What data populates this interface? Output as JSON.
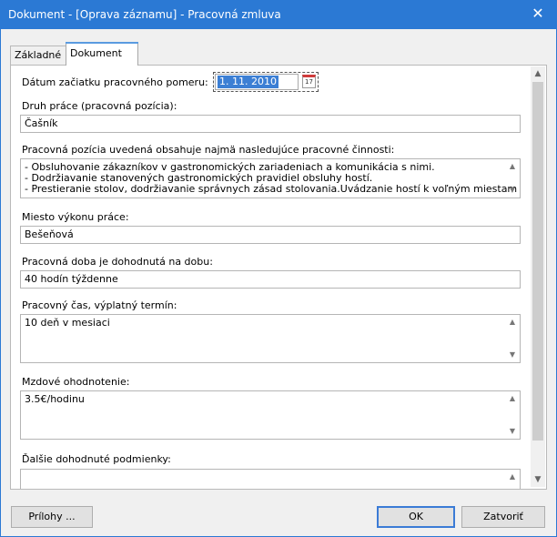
{
  "window": {
    "title": "Dokument - [Oprava záznamu]  - Pracovná zmluva",
    "close_glyph": "✕"
  },
  "tabs": [
    {
      "label": "Základné"
    },
    {
      "label": "Dokument"
    }
  ],
  "date_start": {
    "label": "Dátum začiatku pracovného pomeru:",
    "value": "1. 11. 2010",
    "calendar_text": "17"
  },
  "job_type": {
    "label": "Druh práce (pracovná pozícia):",
    "value": "Čašník"
  },
  "activities": {
    "label": "Pracovná pozícia uvedená obsahuje najmä nasledujúce pracovné činnosti:",
    "lines": [
      "- Obsluhovanie zákazníkov v gastronomických zariadeniach a komunikácia s nimi.",
      "- Dodržiavanie stanovených gastronomických pravidiel obsluhy hostí.",
      "- Prestieranie stolov, dodržiavanie správnych zásad stolovania.Uvádzanie hostí k voľným miestam na"
    ]
  },
  "place": {
    "label": "Miesto výkonu práce:",
    "value": "Bešeňová"
  },
  "duration": {
    "label": "Pracovná doba je dohodnutá na dobu:",
    "value": "40 hodín týždenne"
  },
  "work_time": {
    "label": "Pracovný čas, výplatný termín:",
    "value": "10 deň v mesiaci"
  },
  "wage": {
    "label": "Mzdové ohodnotenie:",
    "value": "3.5€/hodinu"
  },
  "other": {
    "label": "Ďalšie dohodnuté podmienky:",
    "value": ""
  },
  "buttons": {
    "attachments": "Prílohy ...",
    "ok": "OK",
    "close": "Zatvoriť"
  },
  "glyphs": {
    "up": "▲",
    "down": "▼"
  },
  "colors": {
    "titlebar": "#2b79d4",
    "selection": "#3c7fd4",
    "ok_border": "#3b7bd6"
  }
}
